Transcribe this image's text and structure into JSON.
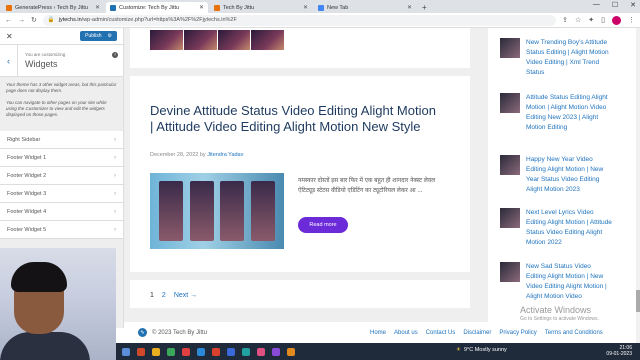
{
  "browser": {
    "tabs": [
      {
        "label": "GeneratePress › Tech By Jittu",
        "favicon_color": "#e8710a"
      },
      {
        "label": "Customize: Tech By Jittu",
        "favicon_color": "#2271b1"
      },
      {
        "label": "Tech By Jittu",
        "favicon_color": "#e8710a"
      },
      {
        "label": "New Tab",
        "favicon_color": "#4285f4"
      }
    ],
    "active_tab": 1,
    "url_host": "jytechs.in",
    "url_path": "/wp-admin/customize.php?url=https%3A%2F%2Fjytechs.in%2F"
  },
  "customizer": {
    "publish_label": "Publish",
    "subtitle": "You are customizing",
    "title": "Widgets",
    "notice": "Your theme has 3 other widget areas, but this particular page does not display them.",
    "help": "You can navigate to other pages on your site while using the Customizer to view and edit the widgets displayed on those pages.",
    "areas": [
      "Right Sidebar",
      "Footer Widget 1",
      "Footer Widget 2",
      "Footer Widget 3",
      "Footer Widget 4",
      "Footer Widget 5"
    ]
  },
  "post": {
    "title": "Devine Attitude Status Video Editing Alight Motion | Attitude Video Editing Alight Motion New Style",
    "date": "December 28, 2022",
    "by": "by",
    "author": "Jitendra Yadav",
    "excerpt": "नमस्कार दोस्तों इस बार फिर में एक बहुत ही शानदार नेक्स्ट लेवल ऐटिट्यूड स्टेटस वीडियो एडिटिंग का ट्यूटोरियल लेकर आ ...",
    "read_more": "Read more"
  },
  "pagination": {
    "pages": [
      "1",
      "2"
    ],
    "next": "Next →"
  },
  "sidebar_posts": [
    "New Trending Boy's Attitude Status Editing | Alight Motion Video Editing | Xml Trend Status",
    "Attitude Status Editing Alight Motion | Alight Motion Video Editing New 2023 | Alight Motion Editing",
    "Happy New Year Video Editing Alight Motion | New Year Status Video Editing Alight Motion 2023",
    "Next Level Lyrics Video Editing Alight Motion | Attitude Status Video Editing Alight Motion 2022",
    "New Sad Status Video Editing Alight Motion | New Video Editing Alight Motion | Alight Motion Video"
  ],
  "footer": {
    "copyright": "© 2023 Tech By Jittu",
    "links": [
      "Home",
      "About us",
      "Contact Us",
      "Disclaimer",
      "Privacy Policy",
      "Terms and Conditions"
    ]
  },
  "watermark": {
    "line1": "Activate Windows",
    "line2": "Go to Settings to activate Windows."
  },
  "taskbar": {
    "weather": "9°C  Mostly sunny",
    "time": "21:06",
    "date": "09-01-2023"
  }
}
